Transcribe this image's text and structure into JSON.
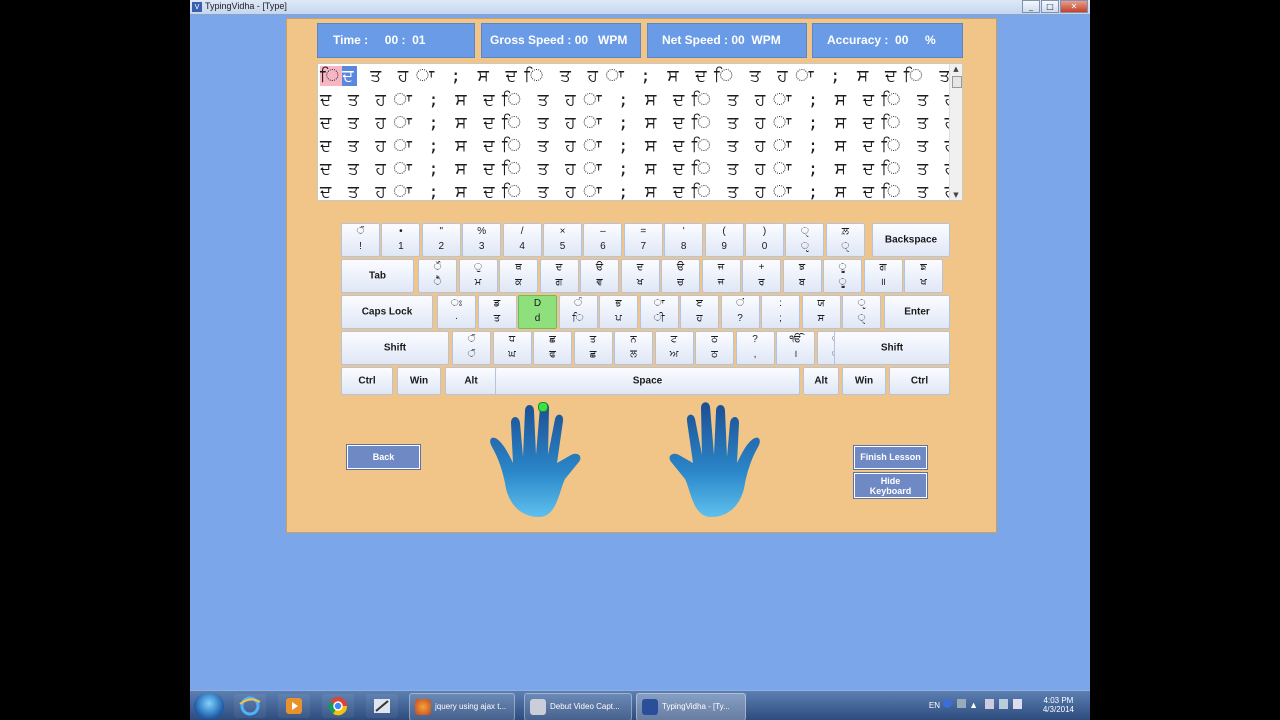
{
  "window": {
    "title": "TypingVidha - [Type]",
    "icon_label": "V",
    "minimize": "_",
    "maximize": "□",
    "close": "✕"
  },
  "stats": {
    "time": "Time :     00 :  01",
    "gross": "Gross Speed : 00   WPM",
    "net": "Net Speed : 00  WPM",
    "accuracy": "Accuracy :  00     %"
  },
  "lesson": {
    "first_line_typed": "ਿ",
    "first_line_cursor": "ਦ",
    "first_line_rest": "ਤ ਹ ਾ ; ਸ ਦ ਿ ਤ ਹ ਾ ; ਸ ਦ ਿ ਤ ਹ ਾ ; ਸ ਦ ਿ ਤ ਹ ਾ ; ਸ ਦ ਿ ਤ ਹ ਾ ; ਸ ਿ",
    "lines": [
      "ਦ ਤ ਹ ਾ ; ਸ ਦ ਿ ਤ ਹ ਾ ; ਸ ਦ ਿ ਤ ਹ ਾ ; ਸ ਦ ਿ ਤ ਹ ਾ ; ਸ ਦ ਿ ਤ ਹ ਾ ; ਸ ਿ",
      "ਦ ਤ ਹ ਾ ; ਸ ਦ ਿ ਤ ਹ ਾ ; ਸ ਦ ਿ ਤ ਹ ਾ ; ਸ ਦ ਿ ਤ ਹ ਾ ; ਸ ਦ ਿ ਤ ਹ ਾ ; ਸ ਿ",
      "ਦ ਤ ਹ ਾ ; ਸ ਦ ਿ ਤ ਹ ਾ ; ਸ ਦ ਿ ਤ ਹ ਾ ; ਸ ਦ ਿ ਤ ਹ ਾ ; ਸ ਦ ਿ ਤ ਹ ਾ ; ਸ ਿ",
      "ਦ ਤ ਹ ਾ ; ਸ ਦ ਿ ਤ ਹ ਾ ; ਸ ਦ ਿ ਤ ਹ ਾ ; ਸ ਦ ਿ ਤ ਹ ਾ ; ਸ ਦ ਿ ਤ ਹ ਾ ; ਸ ਿ",
      "ਦ ਤ ਹ ਾ ; ਸ ਦ ਿ ਤ ਹ ਾ ; ਸ ਦ ਿ ਤ ਹ ਾ ; ਸ ਦ ਿ ਤ ਹ ਾ ; ਸ ਦ ਿ ਤ ਹ ਾ ; ਸ ਿ"
    ]
  },
  "keyboard": {
    "row1": [
      {
        "t": "ੱ",
        "b": "!"
      },
      {
        "t": "•",
        "b": "1"
      },
      {
        "t": "\"",
        "b": "2"
      },
      {
        "t": "%",
        "b": "3"
      },
      {
        "t": "/",
        "b": "4"
      },
      {
        "t": "×",
        "b": "5"
      },
      {
        "t": "–",
        "b": "6"
      },
      {
        "t": "=",
        "b": "7"
      },
      {
        "t": "'",
        "b": "8"
      },
      {
        "t": "(",
        "b": "9"
      },
      {
        "t": ")",
        "b": "0"
      },
      {
        "t": "ੑ",
        "b": "ੵ"
      },
      {
        "t": "ਲ਼",
        "b": "ੑ"
      }
    ],
    "backspace": "Backspace",
    "tab": "Tab",
    "row2": [
      {
        "t": "ੌ",
        "b": "ੈ"
      },
      {
        "t": "ੁ",
        "b": "ਮ"
      },
      {
        "t": "ਥ",
        "b": "ਕ"
      },
      {
        "t": "ਦ",
        "b": "ਗ"
      },
      {
        "t": "ੳ",
        "b": "ਵ"
      },
      {
        "t": "ਦ",
        "b": "ਖ"
      },
      {
        "t": "ੳ",
        "b": "ਚ"
      },
      {
        "t": "ਜ",
        "b": "ਜ"
      },
      {
        "t": "+",
        "b": "ਰ"
      },
      {
        "t": "ਝ",
        "b": "ਬ"
      },
      {
        "t": "ੂ",
        "b": "ੂ"
      },
      {
        "t": "ਗ",
        "b": "॥"
      },
      {
        "t": "ਙ",
        "b": "ਖ"
      }
    ],
    "caps": "Caps Lock",
    "row3": [
      {
        "t": "ਃ",
        "b": "·"
      },
      {
        "t": "ਡ",
        "b": "ਤ"
      },
      {
        "t": "D",
        "b": "d"
      },
      {
        "t": "ੰ",
        "b": "ਿ"
      },
      {
        "t": "ਭ",
        "b": "ਪ"
      },
      {
        "t": "ਾ",
        "b": "ੀ"
      },
      {
        "t": "ੲ",
        "b": "ਹ"
      },
      {
        "t": "ਂ",
        "b": "?"
      },
      {
        "t": ":",
        "b": ";"
      },
      {
        "t": "ਯ",
        "b": "ਸ"
      },
      {
        "t": "ੵ",
        "b": "ੑ"
      }
    ],
    "enter": "Enter",
    "shift_left": "Shift",
    "row4": [
      {
        "t": "ੱ",
        "b": "ੱ"
      },
      {
        "t": "ਧ",
        "b": "ਘ"
      },
      {
        "t": "ਛ",
        "b": "ਫ"
      },
      {
        "t": "ਤ",
        "b": "ਛ"
      },
      {
        "t": "ਨ",
        "b": "ਲ"
      },
      {
        "t": "ਟ",
        "b": "ਅ"
      },
      {
        "t": "ਠ",
        "b": "ਠ"
      },
      {
        "t": "?",
        "b": ","
      },
      {
        "t": "ੴ",
        "b": "।"
      },
      {
        "t": "ੑ",
        "b": "ੑ"
      }
    ],
    "shift_right": "Shift",
    "row5": [
      "Ctrl",
      "Win",
      "Alt",
      "Space",
      "Alt",
      "Win",
      "Ctrl"
    ],
    "active_key": "D"
  },
  "buttons": {
    "back": "Back",
    "finish": "Finish Lesson",
    "hide": "Hide Keyboard"
  },
  "colors": {
    "background": "#7ba6ea",
    "panel": "#f1c587",
    "stat": "#6a9be6",
    "active_key": "#8ee07c",
    "hand": "#2a7bbd"
  },
  "taskbar": {
    "tasks": [
      "jquery using ajax t...",
      "Debut Video Capt...",
      "TypingVidha - [Ty..."
    ],
    "lang": "EN",
    "time": "4:03 PM",
    "date": "4/3/2014"
  }
}
